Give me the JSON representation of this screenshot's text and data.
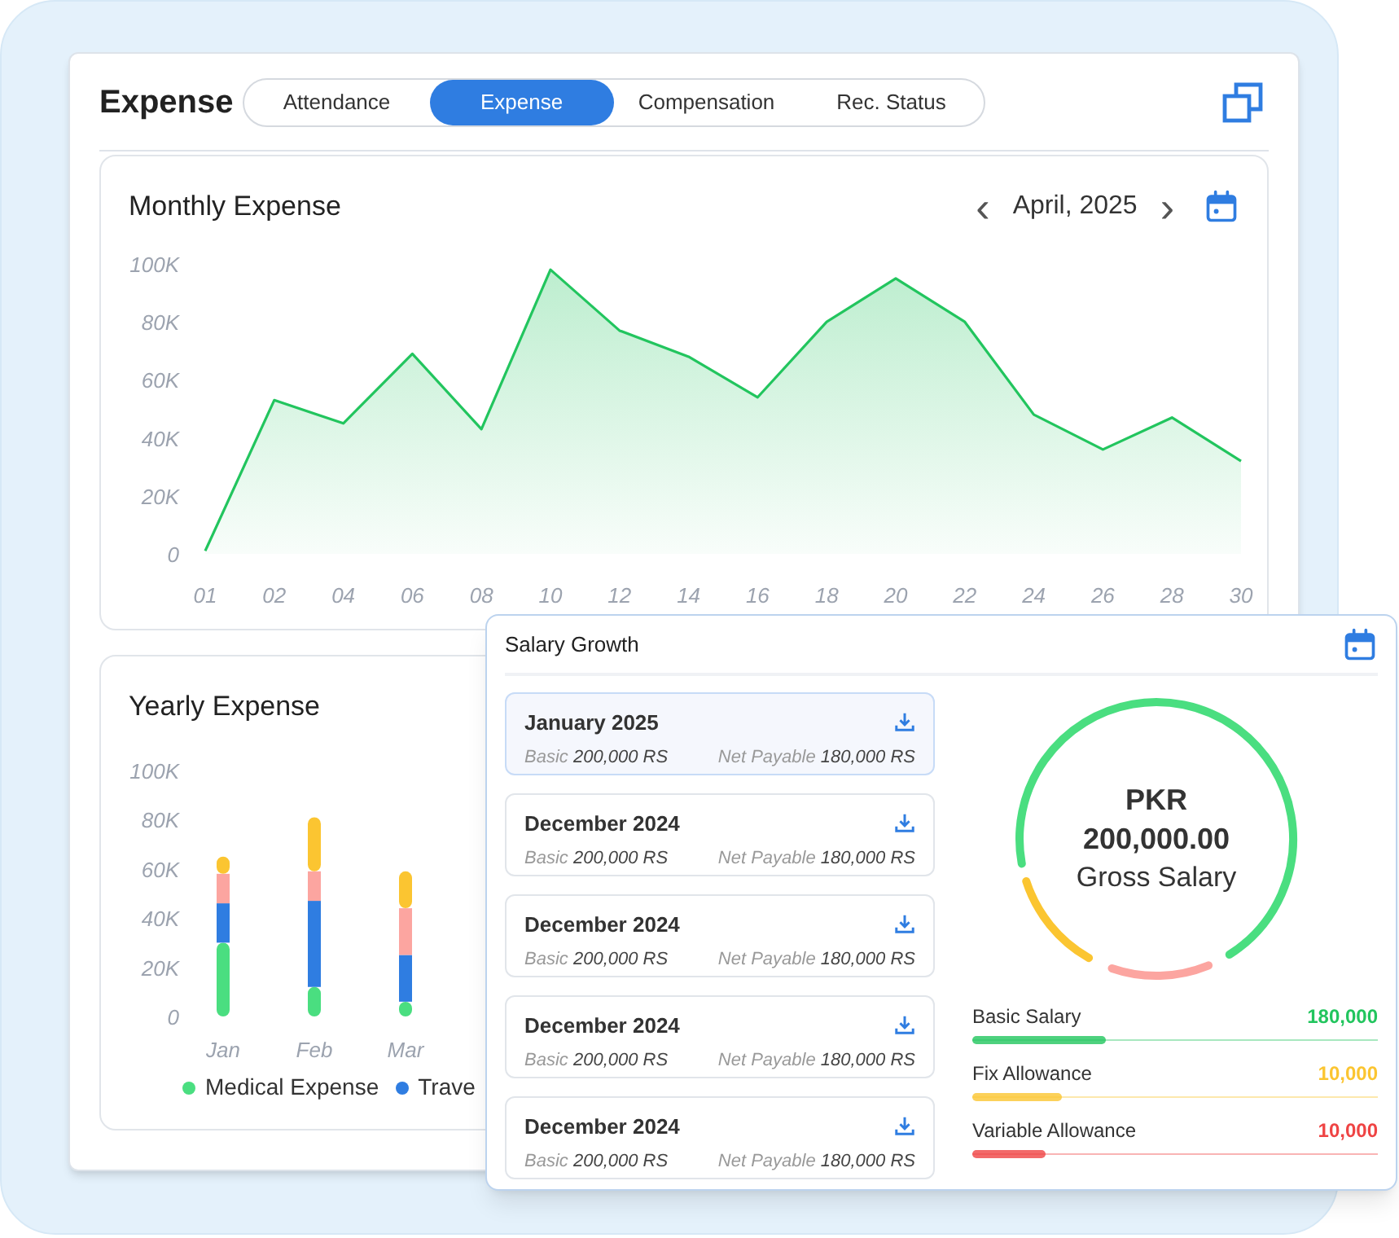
{
  "header": {
    "title": "Expense",
    "tabs": [
      {
        "label": "Attendance",
        "selected": false
      },
      {
        "label": "Expense",
        "selected": true
      },
      {
        "label": "Compensation",
        "selected": false
      },
      {
        "label": "Rec. Status",
        "selected": false
      }
    ]
  },
  "monthly_expense": {
    "title": "Monthly Expense",
    "period": "April, 2025",
    "prev": "‹",
    "next": "›",
    "chart_data": {
      "type": "area",
      "categories": [
        "01",
        "02",
        "04",
        "06",
        "08",
        "10",
        "12",
        "14",
        "16",
        "18",
        "20",
        "22",
        "24",
        "26",
        "28",
        "30"
      ],
      "ylim": [
        0,
        100000
      ],
      "yticks": [
        {
          "value": 0,
          "label": "0"
        },
        {
          "value": 20000,
          "label": "20K"
        },
        {
          "value": 40000,
          "label": "40K"
        },
        {
          "value": 60000,
          "label": "60K"
        },
        {
          "value": 80000,
          "label": "80K"
        },
        {
          "value": 100000,
          "label": "100K"
        }
      ],
      "series": [
        {
          "color": "#22c55e",
          "values": [
            1000,
            53000,
            45000,
            69000,
            43000,
            98000,
            77000,
            68000,
            54000,
            80000,
            95000,
            80000,
            48000,
            36000,
            47000,
            32000
          ]
        }
      ]
    }
  },
  "yearly_expense": {
    "title": "Yearly Expense",
    "chart_data": {
      "type": "bar",
      "stacked": true,
      "categories": [
        "Jan",
        "Feb",
        "Mar"
      ],
      "ylim": [
        0,
        100000
      ],
      "yticks": [
        {
          "value": 0,
          "label": "0"
        },
        {
          "value": 20000,
          "label": "20K"
        },
        {
          "value": 40000,
          "label": "40K"
        },
        {
          "value": 60000,
          "label": "60K"
        },
        {
          "value": 80000,
          "label": "80K"
        },
        {
          "value": 100000,
          "label": "100K"
        }
      ],
      "series": [
        {
          "name": "Medical Expense",
          "color": "#4ade80",
          "values": [
            30000,
            12000,
            6000
          ]
        },
        {
          "name": "Trave",
          "color": "#2f7de1",
          "values": [
            16000,
            35000,
            19000
          ]
        },
        {
          "color": "#fca5a0",
          "values": [
            12000,
            12000,
            19000
          ]
        },
        {
          "color": "#fbc531",
          "values": [
            7000,
            22000,
            15000
          ]
        }
      ]
    }
  },
  "salary_growth": {
    "title": "Salary Growth",
    "slips": [
      {
        "month": "January 2025",
        "basic_label": "Basic",
        "basic": "200,000 RS",
        "net_label": "Net Payable",
        "net": "180,000 RS",
        "selected": true
      },
      {
        "month": "December 2024",
        "basic_label": "Basic",
        "basic": "200,000 RS",
        "net_label": "Net Payable",
        "net": "180,000 RS",
        "selected": false
      },
      {
        "month": "December 2024",
        "basic_label": "Basic",
        "basic": "200,000 RS",
        "net_label": "Net Payable",
        "net": "180,000 RS",
        "selected": false
      },
      {
        "month": "December 2024",
        "basic_label": "Basic",
        "basic": "200,000 RS",
        "net_label": "Net Payable",
        "net": "180,000 RS",
        "selected": false
      },
      {
        "month": "December 2024",
        "basic_label": "Basic",
        "basic": "200,000 RS",
        "net_label": "Net Payable",
        "net": "180,000 RS",
        "selected": false
      }
    ],
    "gross": {
      "currency": "PKR",
      "amount": "200,000.00",
      "label": "Gross Salary"
    },
    "components": [
      {
        "label": "Basic Salary",
        "value": "180,000",
        "color": "#22c55e",
        "level": 0.33
      },
      {
        "label": "Fix Allowance",
        "value": "10,000",
        "color": "#fbc531",
        "level": 0.22
      },
      {
        "label": "Variable Allowance",
        "value": "10,000",
        "color": "#ef4444",
        "level": 0.18
      }
    ]
  }
}
